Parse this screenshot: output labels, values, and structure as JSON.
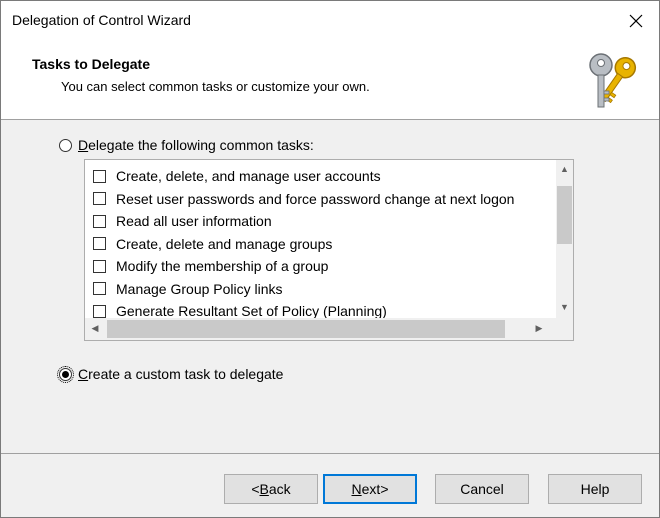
{
  "window": {
    "title": "Delegation of Control Wizard"
  },
  "header": {
    "title": "Tasks to Delegate",
    "subtitle": "You can select common tasks or customize your own.",
    "icon": "keys-icon"
  },
  "options": {
    "common": {
      "label": "Delegate the following common tasks:",
      "checked": false
    },
    "custom": {
      "label": "Create a custom task to delegate",
      "checked": true
    }
  },
  "tasks": [
    {
      "label": "Create, delete, and manage user accounts",
      "checked": false
    },
    {
      "label": "Reset user passwords and force password change at next logon",
      "checked": false
    },
    {
      "label": "Read all user information",
      "checked": false
    },
    {
      "label": "Create, delete and manage groups",
      "checked": false
    },
    {
      "label": "Modify the membership of a group",
      "checked": false
    },
    {
      "label": "Manage Group Policy links",
      "checked": false
    },
    {
      "label": "Generate Resultant Set of Policy (Planning)",
      "checked": false
    }
  ],
  "buttons": {
    "back": {
      "mnemonic": "B",
      "rest": "ack",
      "prefix": "< "
    },
    "next": {
      "mnemonic": "N",
      "rest": "ext",
      "suffix": " >"
    },
    "cancel": {
      "label": "Cancel"
    },
    "help": {
      "label": "Help"
    }
  },
  "colors": {
    "accent": "#0078d7",
    "header_bg": "#ffffff",
    "body_bg": "#f0f0f0"
  }
}
